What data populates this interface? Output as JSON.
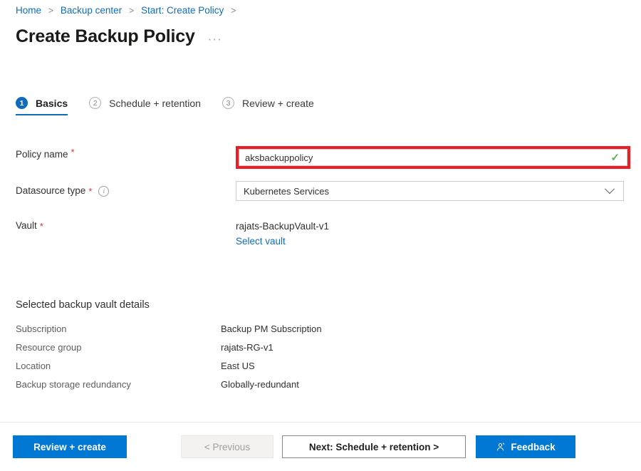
{
  "breadcrumb": {
    "separator": ">",
    "items": [
      {
        "label": "Home"
      },
      {
        "label": "Backup center"
      },
      {
        "label": "Start: Create Policy"
      }
    ]
  },
  "header": {
    "title": "Create Backup Policy",
    "more_menu": "···"
  },
  "tabs": [
    {
      "number": "1",
      "label": "Basics",
      "active": true
    },
    {
      "number": "2",
      "label": "Schedule + retention",
      "active": false
    },
    {
      "number": "3",
      "label": "Review + create",
      "active": false
    }
  ],
  "form": {
    "policy_name": {
      "label": "Policy name",
      "required_marker": "*",
      "value": "aksbackuppolicy",
      "placeholder": "",
      "valid_icon": "check-icon",
      "annotation_color": "#ee1c25"
    },
    "datasource_type": {
      "label": "Datasource type",
      "required_marker": "*",
      "info_icon": "i",
      "selected": "Kubernetes Services",
      "chevron": "chevron-down-icon"
    },
    "vault": {
      "label": "Vault",
      "required_marker": "*",
      "value": "rajats-BackupVault-v1",
      "link": "Select vault"
    }
  },
  "vault_details": {
    "heading": "Selected backup vault details",
    "rows": [
      {
        "key": "Subscription",
        "value": "Backup PM Subscription"
      },
      {
        "key": "Resource group",
        "value": "rajats-RG-v1"
      },
      {
        "key": "Location",
        "value": "East US"
      },
      {
        "key": "Backup storage redundancy",
        "value": "Globally-redundant"
      }
    ]
  },
  "footer": {
    "review_create": "Review + create",
    "previous": "< Previous",
    "next": "Next: Schedule + retention >",
    "feedback": "Feedback"
  },
  "colors": {
    "accent": "#0078d4",
    "link": "#0f6cbd",
    "required": "#d13438",
    "annotation": "#ee1c25",
    "success": "#5ab55a"
  }
}
